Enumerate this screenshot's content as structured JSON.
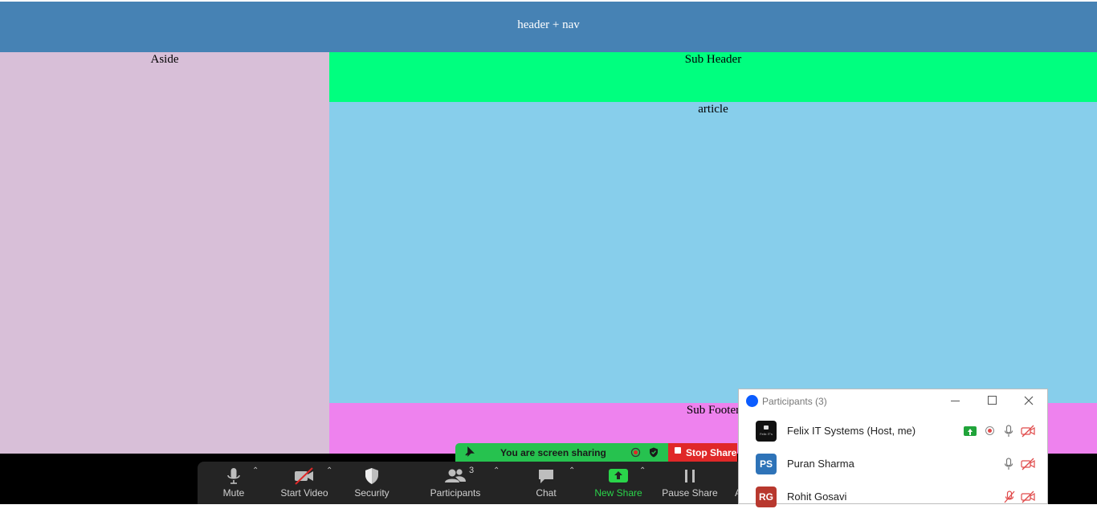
{
  "page": {
    "header": "header + nav",
    "aside": "Aside",
    "sub_header": "Sub Header",
    "article": "article",
    "sub_footer": "Sub Footer",
    "colors": {
      "header": "#4682b4",
      "aside": "#d8bfd8",
      "sub_header": "#00ff7f",
      "article": "#87ceeb",
      "sub_footer": "#ee82ee"
    }
  },
  "share_bar": {
    "status": "You are screen sharing",
    "stop_label": "Stop Share",
    "icons": [
      "pin-icon",
      "record-icon",
      "shield-icon"
    ]
  },
  "toolbar": {
    "items": [
      {
        "label": "Mute",
        "icon": "microphone-icon"
      },
      {
        "label": "Start Video",
        "icon": "video-off-icon"
      },
      {
        "label": "Security",
        "icon": "shield-icon"
      },
      {
        "label": "Participants",
        "icon": "participants-icon",
        "count": "3"
      },
      {
        "label": "Chat",
        "icon": "chat-icon"
      },
      {
        "label": "New Share",
        "icon": "share-up-icon",
        "accent": "#2ad44a"
      },
      {
        "label": "Pause Share",
        "icon": "pause-icon"
      },
      {
        "label": "A",
        "icon": ""
      }
    ]
  },
  "participants_panel": {
    "title": "Participants (3)",
    "participants": [
      {
        "name": "Felix IT Systems (Host, me)",
        "initials": "",
        "avatar_text": "Felix IT's",
        "avatar_color": "#111111",
        "sharing": true,
        "recording": true,
        "mic": "on",
        "video": "off"
      },
      {
        "name": "Puran Sharma",
        "initials": "PS",
        "avatar_color": "#2e73b8",
        "mic": "on",
        "video": "off"
      },
      {
        "name": "Rohit Gosavi",
        "initials": "RG",
        "avatar_color": "#b8382e",
        "mic": "muted",
        "video": "off"
      }
    ]
  }
}
